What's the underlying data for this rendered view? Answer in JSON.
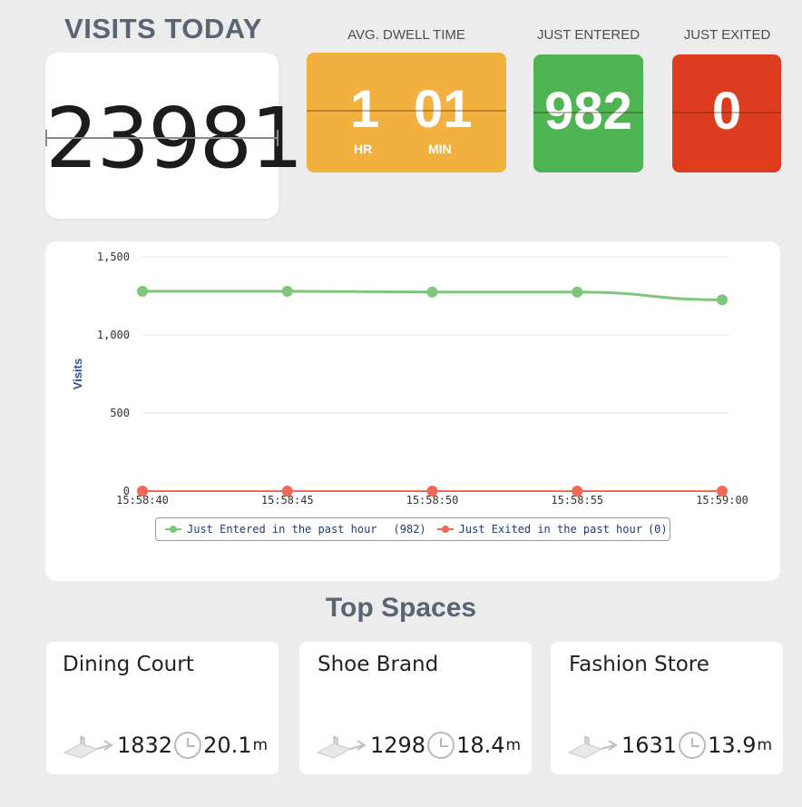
{
  "visits_today": {
    "title": "VISITS TODAY",
    "value": "23981"
  },
  "dwell": {
    "label": "AVG. DWELL TIME",
    "hours": "1",
    "hours_unit": "HR",
    "minutes": "01",
    "minutes_unit": "MIN"
  },
  "entered": {
    "label": "JUST ENTERED",
    "value": "982"
  },
  "exited": {
    "label": "JUST EXITED",
    "value": "0"
  },
  "colors": {
    "dwell": "#f2b13f",
    "entered": "#4eb454",
    "exited": "#dd3c1f",
    "entered_series": "#7cc77a",
    "exited_series": "#ef6a55"
  },
  "chart_data": {
    "type": "line",
    "x": [
      "15:58:40",
      "15:58:45",
      "15:58:50",
      "15:58:55",
      "15:59:00"
    ],
    "series": [
      {
        "name": "Just Entered in the past hour",
        "values": [
          1280,
          1280,
          1275,
          1275,
          1225
        ],
        "color": "#7cc77a"
      },
      {
        "name": "Just Exited in the past hour",
        "values": [
          0,
          0,
          0,
          0,
          0
        ],
        "color": "#ef6a55"
      }
    ],
    "ylabel": "Visits",
    "ylim": [
      0,
      1500
    ],
    "yticks": [
      0,
      500,
      1000,
      1500
    ],
    "ytick_labels": [
      "0",
      "500",
      "1,000",
      "1,500"
    ],
    "grid": true,
    "legend_position": "bottom"
  },
  "legend": {
    "entered_label": "Just Entered in the past hour",
    "entered_count": "(982)",
    "exited_label": "Just Exited in the past hour",
    "exited_count": "(0)"
  },
  "top_spaces": {
    "title": "Top Spaces",
    "items": [
      {
        "name": "Dining Court",
        "count": "1832",
        "time": "20.1",
        "unit": "m"
      },
      {
        "name": "Shoe Brand",
        "count": "1298",
        "time": "18.4",
        "unit": "m"
      },
      {
        "name": "Fashion Store",
        "count": "1631",
        "time": "13.9",
        "unit": "m"
      }
    ]
  }
}
